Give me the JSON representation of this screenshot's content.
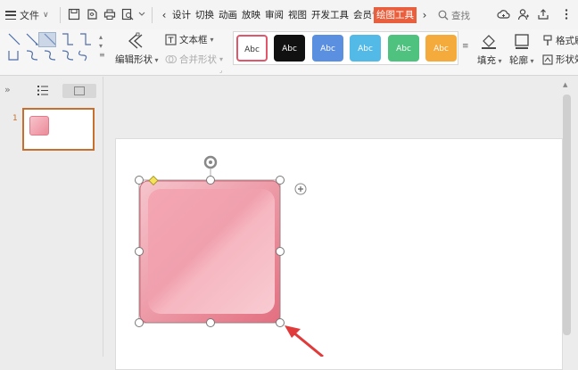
{
  "menu": {
    "file_label": "文件",
    "tabs": [
      "设计",
      "切换",
      "动画",
      "放映",
      "审阅",
      "视图",
      "开发工具",
      "会员专享"
    ],
    "active_tab": "绘图工具",
    "search_placeholder": "查找"
  },
  "toolbar": {
    "edit_shape_label": "编辑形状",
    "textbox_label": "文本框",
    "merge_shape_label": "合并形状",
    "style_presets": [
      {
        "label": "Abc",
        "bg": "#ffffff",
        "fg": "#333333",
        "border": "#e0566a"
      },
      {
        "label": "Abc",
        "bg": "#111111",
        "fg": "#ffffff",
        "border": "#111111"
      },
      {
        "label": "Abc",
        "bg": "#5b8fe0",
        "fg": "#ffffff",
        "border": "#5b8fe0"
      },
      {
        "label": "Abc",
        "bg": "#53b9e6",
        "fg": "#ffffff",
        "border": "#53b9e6"
      },
      {
        "label": "Abc",
        "bg": "#4fc27f",
        "fg": "#ffffff",
        "border": "#4fc27f"
      },
      {
        "label": "Abc",
        "bg": "#f5aa3c",
        "fg": "#ffffff",
        "border": "#f5aa3c"
      }
    ],
    "fill_label": "填充",
    "outline_label": "轮廓",
    "format_painter_label": "格式刷",
    "shape_effect_label": "形状效"
  },
  "slides": {
    "thumbnail_number": "1"
  },
  "colors": {
    "accent_tab": "#e95f3d",
    "shape_pink": "#ef8d9b",
    "selection_handle": "#9a9a9a",
    "arrow_red": "#e03a3a",
    "thumb_border": "#c76f2f"
  }
}
